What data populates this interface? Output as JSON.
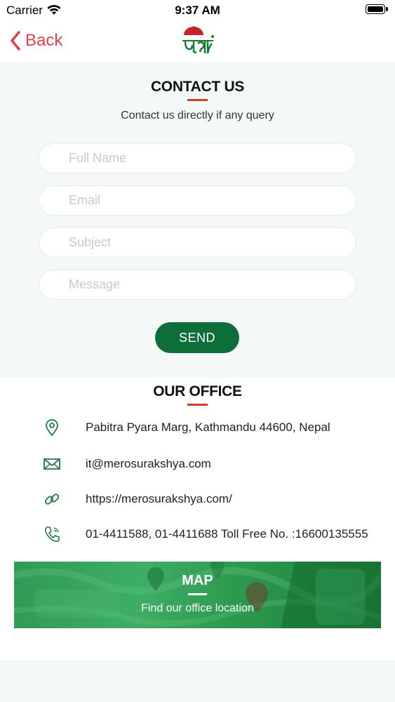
{
  "status_bar": {
    "carrier": "Carrier",
    "time": "9:37 AM"
  },
  "nav": {
    "back_label": "Back",
    "logo_icon": "suraksha-umbrella-logo"
  },
  "contact": {
    "title": "CONTACT US",
    "subtitle": "Contact us directly if any query",
    "fields": {
      "full_name": {
        "placeholder": "Full Name",
        "value": ""
      },
      "email": {
        "placeholder": "Email",
        "value": ""
      },
      "subject": {
        "placeholder": "Subject",
        "value": ""
      },
      "message": {
        "placeholder": "Message",
        "value": ""
      }
    },
    "send_label": "SEND"
  },
  "office": {
    "title": "OUR OFFICE",
    "address": "Pabitra Pyara Marg, Kathmandu 44600, Nepal",
    "email": "it@merosurakshya.com",
    "website": "https://merosurakshya.com/",
    "phone": "01-4411588, 01-4411688 Toll Free No. :16600135555",
    "icons": [
      "location-pin-icon",
      "envelope-icon",
      "link-icon",
      "phone-icon"
    ]
  },
  "map": {
    "title": "MAP",
    "subtitle": "Find our office location"
  },
  "colors": {
    "accent_red": "#d63a2a",
    "back_red": "#e0404a",
    "brand_green": "#0d6e3a",
    "icon_green": "#1e7a45",
    "section_bg": "#f4f9f8"
  }
}
